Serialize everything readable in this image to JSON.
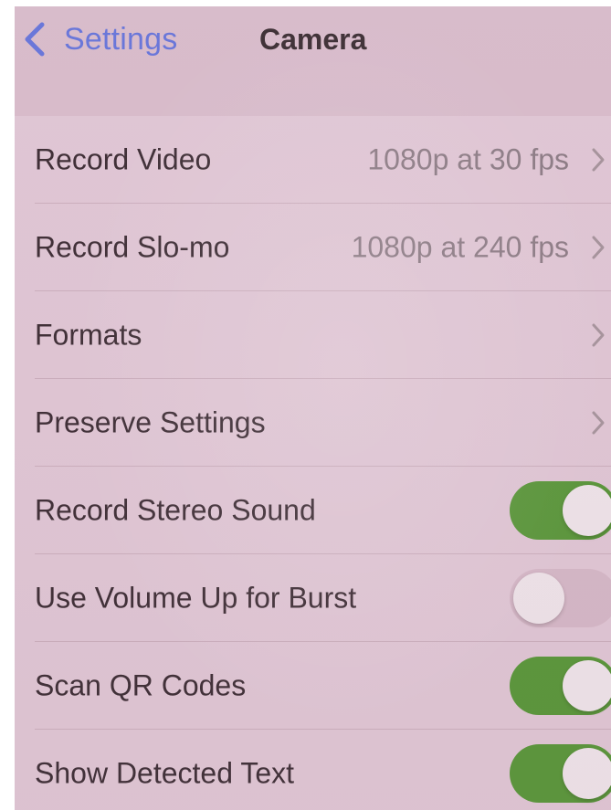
{
  "nav": {
    "back_label": "Settings",
    "title": "Camera"
  },
  "rows": [
    {
      "label": "Record Video",
      "value": "1080p at 30 fps",
      "accessory": "chevron"
    },
    {
      "label": "Record Slo-mo",
      "value": "1080p at 240 fps",
      "accessory": "chevron"
    },
    {
      "label": "Formats",
      "accessory": "chevron"
    },
    {
      "label": "Preserve Settings",
      "accessory": "chevron"
    },
    {
      "label": "Record Stereo Sound",
      "accessory": "toggle",
      "on": true
    },
    {
      "label": "Use Volume Up for Burst",
      "accessory": "toggle",
      "on": false
    },
    {
      "label": "Scan QR Codes",
      "accessory": "toggle",
      "on": true
    },
    {
      "label": "Show Detected Text",
      "accessory": "toggle",
      "on": true
    }
  ],
  "colors": {
    "accent_blue": "#6a79de",
    "toggle_on": "#5a9a3a",
    "toggle_off": "#d9bccb"
  }
}
